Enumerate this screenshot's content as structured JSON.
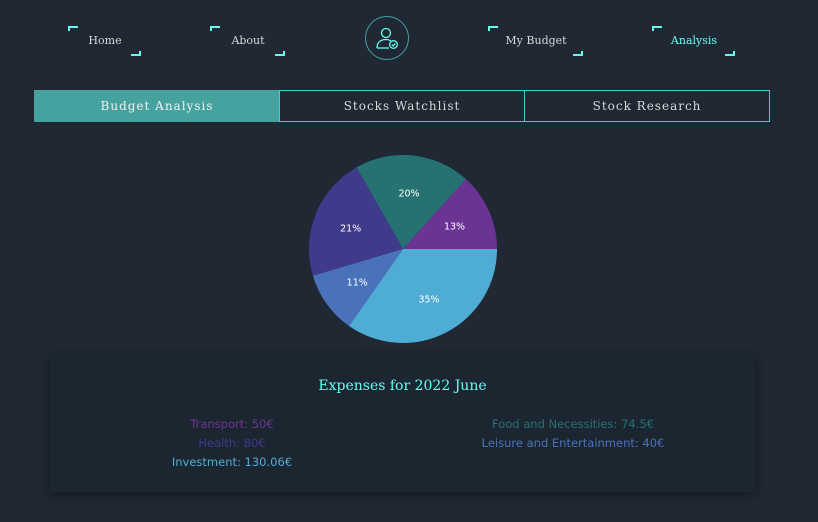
{
  "nav": {
    "home": "Home",
    "about": "About",
    "my_budget": "My Budget",
    "analysis": "Analysis",
    "accent": "#66fcf1"
  },
  "tabs": [
    {
      "label": "Budget Analysis",
      "active": true
    },
    {
      "label": "Stocks Watchlist",
      "active": false
    },
    {
      "label": "Stock Research",
      "active": false
    }
  ],
  "chart_data": {
    "type": "pie",
    "slices": [
      {
        "label": "Transport",
        "value": 50,
        "percent_label": "13%",
        "color": "#6b3494"
      },
      {
        "label": "Food and Necessities",
        "value": 74.5,
        "percent_label": "20%",
        "color": "#267272"
      },
      {
        "label": "Health",
        "value": 80,
        "percent_label": "21%",
        "color": "#3f3a8c"
      },
      {
        "label": "Leisure and Entertainment",
        "value": 40,
        "percent_label": "11%",
        "color": "#4a72ba"
      },
      {
        "label": "Investment",
        "value": 130.06,
        "percent_label": "35%",
        "color": "#4fadd5"
      }
    ]
  },
  "expenses": {
    "title": "Expenses for 2022 June",
    "left": [
      {
        "text": "Transport: 50€",
        "color": "#6b3494"
      },
      {
        "text": "Health: 80€",
        "color": "#3f3a8c"
      },
      {
        "text": "Investment: 130.06€",
        "color": "#4fadd5"
      }
    ],
    "right": [
      {
        "text": "Food and Necessities: 74.5€",
        "color": "#267272"
      },
      {
        "text": "Leisure and Entertainment: 40€",
        "color": "#4a72ba"
      }
    ]
  }
}
